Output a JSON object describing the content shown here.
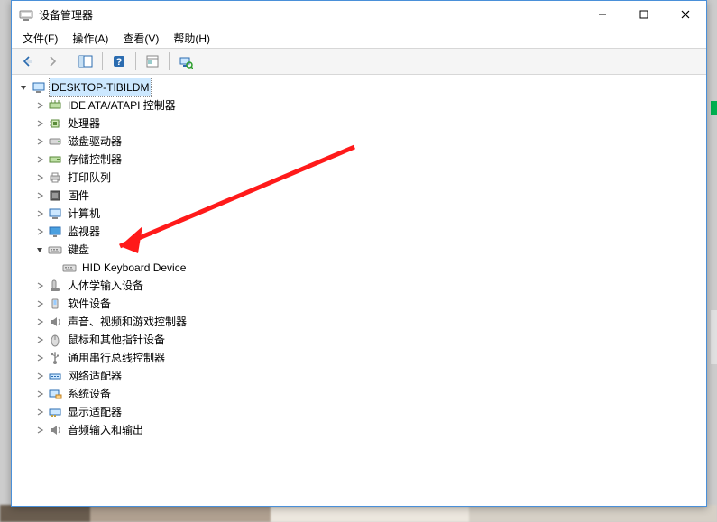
{
  "window": {
    "title": "设备管理器"
  },
  "menu": {
    "file": "文件(F)",
    "action": "操作(A)",
    "view": "查看(V)",
    "help": "帮助(H)"
  },
  "tree": {
    "root": "DESKTOP-TIBILDM",
    "n_ide": "IDE ATA/ATAPI 控制器",
    "n_cpu": "处理器",
    "n_disk": "磁盘驱动器",
    "n_storage": "存储控制器",
    "n_printq": "打印队列",
    "n_firmware": "固件",
    "n_computer": "计算机",
    "n_monitor": "监视器",
    "n_keyboard": "键盘",
    "n_keyboard_child0": "HID Keyboard Device",
    "n_hid": "人体学输入设备",
    "n_software": "软件设备",
    "n_sound": "声音、视频和游戏控制器",
    "n_mouse": "鼠标和其他指针设备",
    "n_usb": "通用串行总线控制器",
    "n_net": "网络适配器",
    "n_system": "系统设备",
    "n_display": "显示适配器",
    "n_audioio": "音频输入和输出"
  }
}
